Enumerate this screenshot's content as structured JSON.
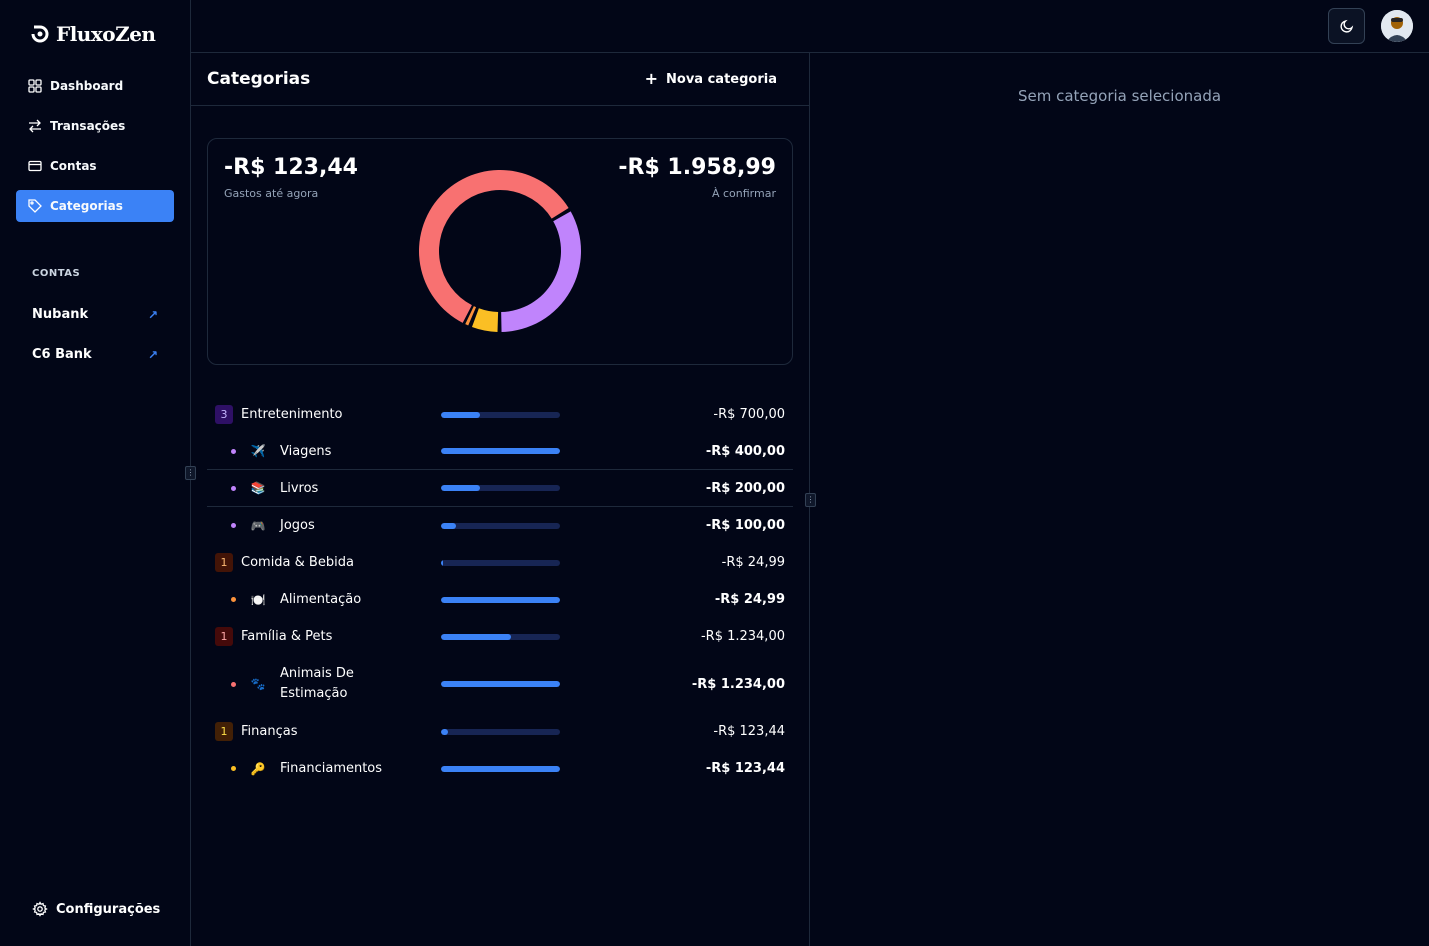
{
  "brand": {
    "name": "FluxoZen"
  },
  "nav": [
    {
      "label": "Dashboard",
      "icon": "dashboard-icon"
    },
    {
      "label": "Transações",
      "icon": "transfer-icon"
    },
    {
      "label": "Contas",
      "icon": "card-icon"
    },
    {
      "label": "Categorias",
      "icon": "tag-icon",
      "active": true
    }
  ],
  "accounts_section": {
    "label": "CONTAS",
    "items": [
      {
        "name": "Nubank",
        "icon": "external-arrow-icon"
      },
      {
        "name": "C6 Bank",
        "icon": "external-arrow-icon"
      }
    ]
  },
  "settings": {
    "label": "Configurações",
    "icon": "gear-icon"
  },
  "topbar": {
    "theme_toggle_icon": "moon-icon",
    "avatar": "user-avatar"
  },
  "categories_panel": {
    "title": "Categorias",
    "new_button": "Nova categoria",
    "summary": {
      "spent_amount": "-R$ 123,44",
      "spent_label": "Gastos até agora",
      "pending_amount": "-R$ 1.958,99",
      "pending_label": "À confirmar",
      "donut": [
        {
          "name": "Família & Pets",
          "value": 1234.0,
          "color": "#f87171"
        },
        {
          "name": "Entretenimento",
          "value": 700.0,
          "color": "#c084fc"
        },
        {
          "name": "Finanças",
          "value": 123.44,
          "color": "#fbbf24"
        },
        {
          "name": "Comida & Bebida",
          "value": 24.99,
          "color": "#fb923c"
        }
      ]
    },
    "groups": [
      {
        "count": "3",
        "name": "Entretenimento",
        "amount": "-R$ 700,00",
        "progress": 0.33,
        "badge_bg": "#2e1065",
        "badge_color": "#c4b5fd",
        "dot": "#c084fc",
        "items": [
          {
            "emoji": "✈️",
            "name": "Viagens",
            "amount": "-R$ 400,00",
            "progress": 1.0
          },
          {
            "emoji": "📚",
            "name": "Livros",
            "amount": "-R$ 200,00",
            "progress": 0.33
          },
          {
            "emoji": "🎮",
            "name": "Jogos",
            "amount": "-R$ 100,00",
            "progress": 0.13
          }
        ]
      },
      {
        "count": "1",
        "name": "Comida & Bebida",
        "amount": "-R$ 24,99",
        "progress": 0.01,
        "badge_bg": "#431407",
        "badge_color": "#fdba74",
        "dot": "#fb923c",
        "items": [
          {
            "emoji": "🍽️",
            "name": "Alimentação",
            "amount": "-R$ 24,99",
            "progress": 1.0
          }
        ]
      },
      {
        "count": "1",
        "name": "Família & Pets",
        "amount": "-R$ 1.234,00",
        "progress": 0.59,
        "badge_bg": "#450a0a",
        "badge_color": "#fca5a5",
        "dot": "#f87171",
        "items": [
          {
            "emoji": "🐾",
            "name": "Animais De Estimação",
            "amount": "-R$ 1.234,00",
            "progress": 1.0
          }
        ]
      },
      {
        "count": "1",
        "name": "Finanças",
        "amount": "-R$ 123,44",
        "progress": 0.06,
        "badge_bg": "#422006",
        "badge_color": "#fde047",
        "dot": "#fbbf24",
        "items": [
          {
            "emoji": "🔑",
            "name": "Financiamentos",
            "amount": "-R$ 123,44",
            "progress": 1.0
          }
        ]
      }
    ]
  },
  "detail_panel": {
    "empty_message": "Sem categoria selecionada"
  }
}
